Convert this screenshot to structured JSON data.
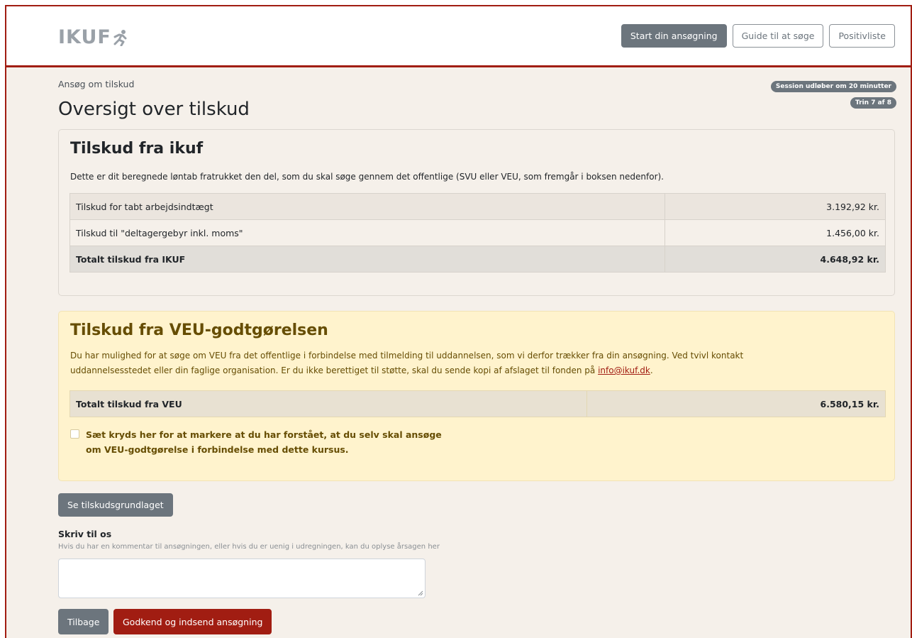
{
  "header": {
    "logo_text": "IKUF",
    "nav": {
      "start": "Start din ansøgning",
      "guide": "Guide til at søge",
      "positive": "Positivliste"
    }
  },
  "page": {
    "breadcrumb": "Ansøg om tilskud",
    "title": "Oversigt over tilskud",
    "session_badge": "Session udløber om 20 minutter",
    "step_badge": "Trin 7 af 8"
  },
  "ikuf": {
    "title": "Tilskud fra ikuf",
    "description": "Dette er dit beregnede løntab fratrukket den del, som du skal søge gennem det offentlige (SVU eller VEU, som fremgår i boksen nedenfor).",
    "rows": [
      {
        "label": "Tilskud for tabt arbejdsindtægt",
        "value": "3.192,92 kr."
      },
      {
        "label": "Tilskud til \"deltagergebyr inkl. moms\"",
        "value": "1.456,00 kr."
      }
    ],
    "total": {
      "label": "Totalt tilskud fra IKUF",
      "value": "4.648,92 kr."
    }
  },
  "veu": {
    "title": "Tilskud fra VEU-godtgørelsen",
    "description_line1": "Du har mulighed for at søge om VEU fra det offentlige i forbindelse med tilmelding til uddannelsen, som vi derfor trækker fra din ansøgning. Ved tvivl kontakt",
    "description_line2": "uddannelsesstedet eller din faglige organisation. Er du ikke berettiget til støtte, skal du sende kopi af afslaget til fonden på ",
    "email": "info@ikuf.dk",
    "description_end": ".",
    "total": {
      "label": "Totalt tilskud fra VEU",
      "value": "6.580,15 kr."
    },
    "checkbox_line1": "Sæt kryds her for at markere at du har forstået, at du selv skal ansøge",
    "checkbox_line2": "om VEU-godtgørelse i forbindelse med dette kursus."
  },
  "actions": {
    "basis_button": "Se tilskudsgrundlaget",
    "comment_label": "Skriv til os",
    "comment_help": "Hvis du har en kommentar til ansøgningen, eller hvis du er uenig i udregningen, kan du oplyse årsagen her",
    "comment_value": "",
    "back_button": "Tilbage",
    "submit_button": "Godkend og indsend ansøgning"
  },
  "colors": {
    "brand_red": "#a11d12",
    "secondary_gray": "#6c757d",
    "warning_bg": "#fff3cd",
    "page_bg": "#f5f0ea"
  },
  "icons": {
    "logo_mark": "person-running-icon"
  }
}
